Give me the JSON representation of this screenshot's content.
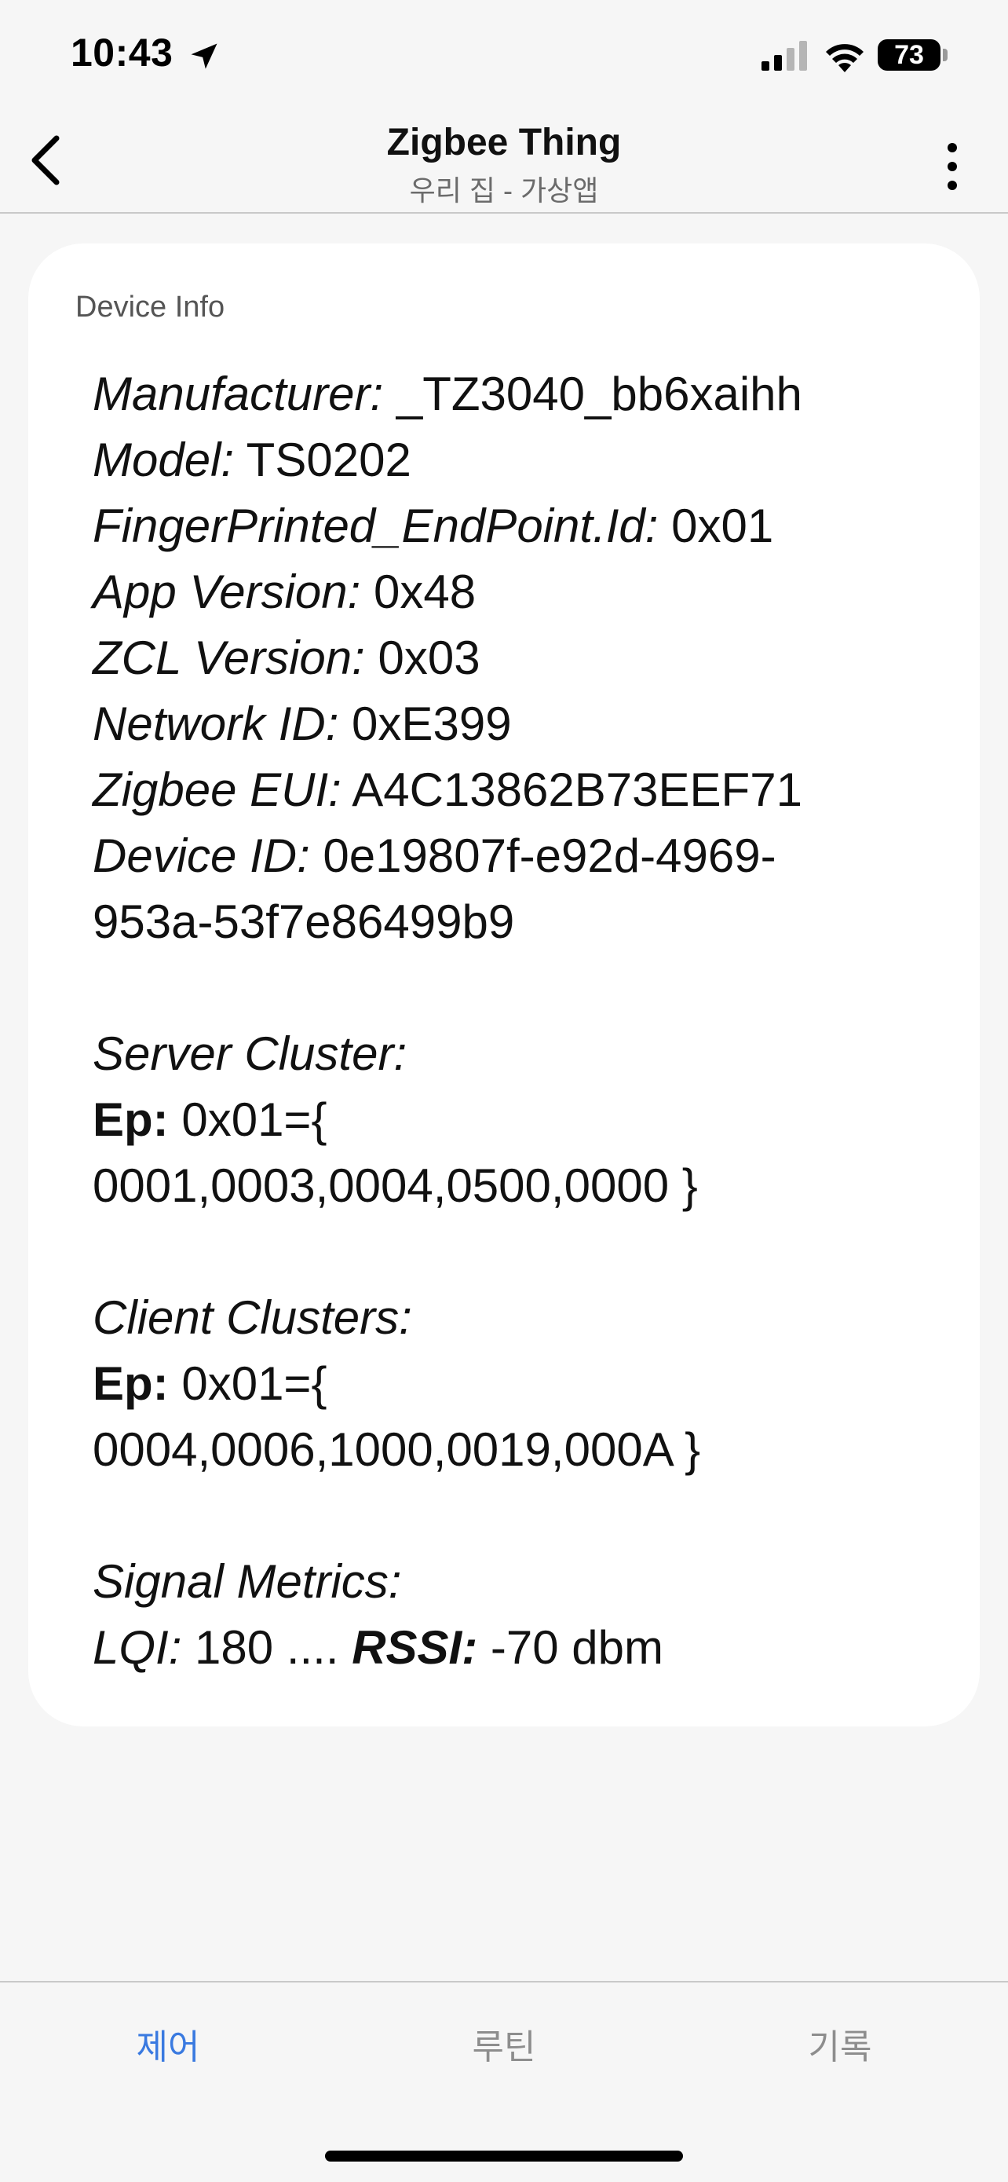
{
  "status_bar": {
    "time": "10:43",
    "battery": "73",
    "icons": [
      "location-arrow-icon",
      "cellular-signal-icon",
      "wifi-icon",
      "battery-icon"
    ]
  },
  "header": {
    "title": "Zigbee Thing",
    "subtitle": "우리 집 - 가상앱",
    "icons": [
      "chevron-left-icon",
      "more-vertical-icon"
    ]
  },
  "card": {
    "label": "Device Info",
    "manufacturer_key": "Manufacturer:",
    "manufacturer_val": " _TZ3040_bb6xaihh",
    "model_key": "Model:",
    "model_val": " TS0202",
    "fingerprint_key": "FingerPrinted_EndPoint.Id:",
    "fingerprint_val": " 0x01",
    "app_version_key": "App Version:",
    "app_version_val": " 0x48",
    "zcl_version_key": "ZCL Version:",
    "zcl_version_val": " 0x03",
    "network_id_key": "Network ID:",
    "network_id_val": " 0xE399",
    "zigbee_eui_key": "Zigbee EUI:",
    "zigbee_eui_val": " A4C13862B73EEF71",
    "device_id_key": "Device ID:",
    "device_id_val_1": " 0e19807f-e92d-4969-",
    "device_id_val_2": "953a-53f7e86499b9",
    "server_cluster_heading": "Server Cluster:",
    "server_ep_key": "Ep:",
    "server_ep_val": " 0x01={",
    "server_cluster_list": "0001,0003,0004,0500,0000 }",
    "client_clusters_heading": "Client Clusters:",
    "client_ep_key": "Ep:",
    "client_ep_val": " 0x01={",
    "client_cluster_list": "0004,0006,1000,0019,000A }",
    "signal_heading": "Signal Metrics:",
    "lqi_key": "LQI:",
    "lqi_val": " 180 .... ",
    "rssi_key": "RSSI:",
    "rssi_val": " -70 dbm"
  },
  "tabs": [
    {
      "label": "제어",
      "active": true
    },
    {
      "label": "루틴",
      "active": false
    },
    {
      "label": "기록",
      "active": false
    }
  ],
  "colors": {
    "accent": "#3a7ae0",
    "background": "#f6f6f6",
    "card": "#ffffff"
  }
}
